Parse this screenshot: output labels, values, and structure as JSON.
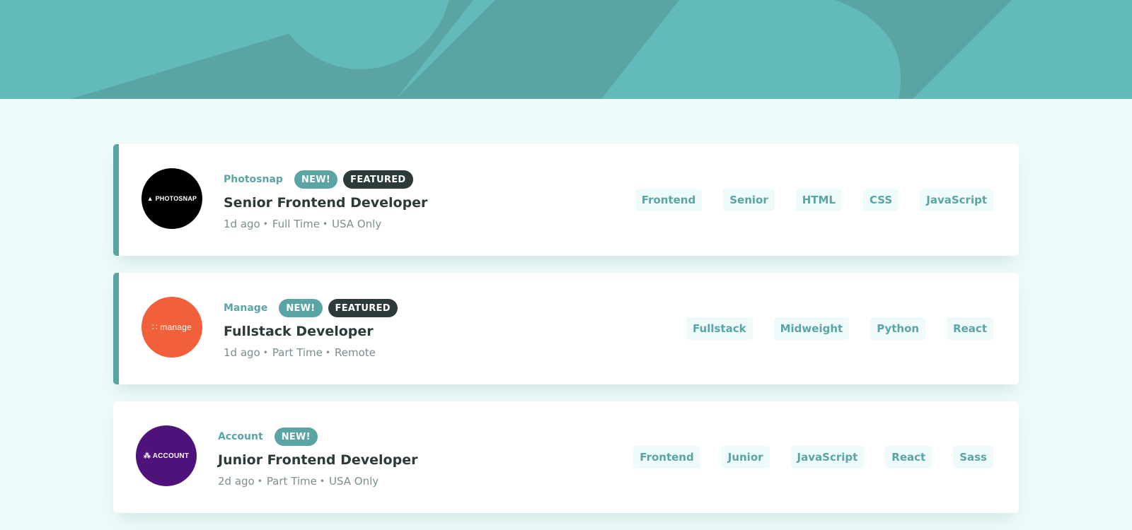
{
  "colors": {
    "primary": "#5ba4a4",
    "header_light": "#63baba",
    "dark": "#2c3a3a",
    "grey": "#7b8e8e",
    "background": "#effafa"
  },
  "jobs": [
    {
      "company": "Photosnap",
      "logo_text": "▲ PHOTOSNAP",
      "logo_color": "#000000",
      "new_label": "NEW!",
      "featured_label": "FEATURED",
      "position": "Senior Frontend Developer",
      "posted": "1d ago",
      "contract": "Full Time",
      "location": "USA Only",
      "tags": [
        "Frontend",
        "Senior",
        "HTML",
        "CSS",
        "JavaScript"
      ]
    },
    {
      "company": "Manage",
      "logo_text": "∷ manage",
      "logo_color": "#f15f3b",
      "new_label": "NEW!",
      "featured_label": "FEATURED",
      "position": "Fullstack Developer",
      "posted": "1d ago",
      "contract": "Part Time",
      "location": "Remote",
      "tags": [
        "Fullstack",
        "Midweight",
        "Python",
        "React"
      ]
    },
    {
      "company": "Account",
      "logo_text": "⁂ ACCOUNT",
      "logo_color": "#4f127b",
      "new_label": "NEW!",
      "position": "Junior Frontend Developer",
      "posted": "2d ago",
      "contract": "Part Time",
      "location": "USA Only",
      "tags": [
        "Frontend",
        "Junior",
        "JavaScript",
        "React",
        "Sass"
      ]
    }
  ]
}
